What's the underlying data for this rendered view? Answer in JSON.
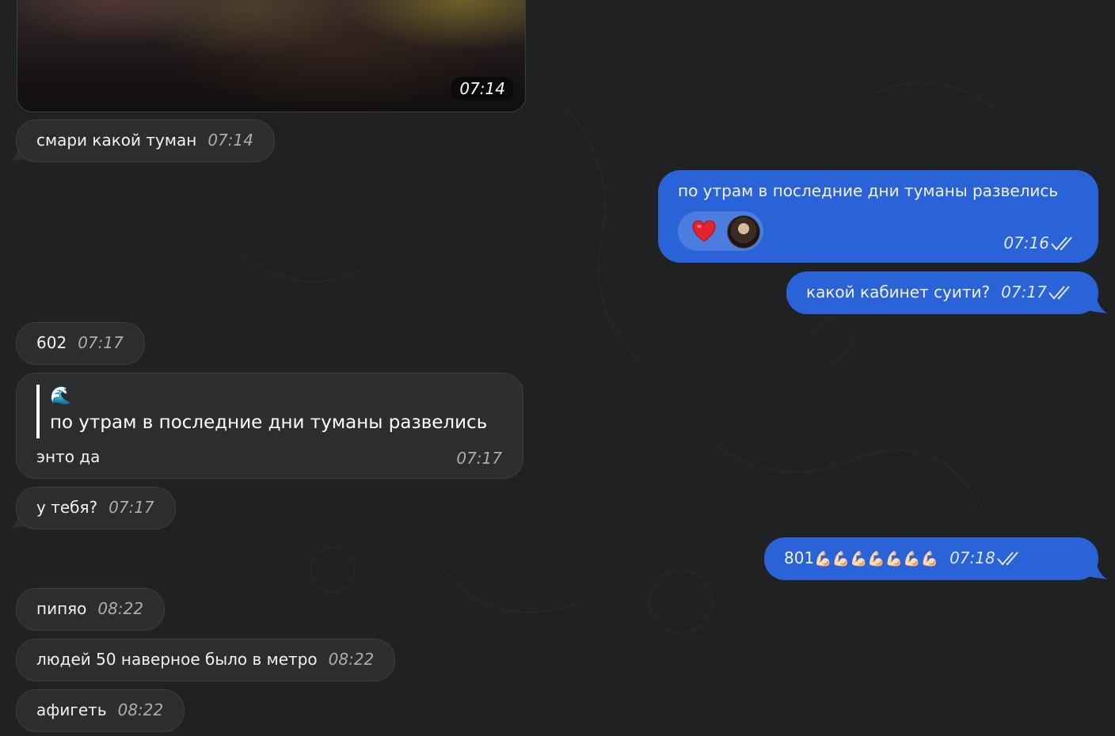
{
  "messages": {
    "photo": {
      "time": "07:14"
    },
    "m1": {
      "text": "смари какой туман",
      "time": "07:14"
    },
    "m2": {
      "text": "по утрам в последние дни туманы развелись",
      "time": "07:16",
      "reaction": "heart"
    },
    "m3": {
      "text": "какой кабинет суити?",
      "time": "07:17"
    },
    "m4": {
      "text": "602",
      "time": "07:17"
    },
    "m5": {
      "quote_emoji": "🌊",
      "quote_text": "по утрам в последние дни туманы развелись",
      "text": "энто да",
      "time": "07:17"
    },
    "m6": {
      "text": "у тебя?",
      "time": "07:17"
    },
    "m7": {
      "text": "801",
      "emoji": "💪🏻💪🏻💪🏻💪🏻💪🏻💪🏻💪🏻",
      "time": "07:18"
    },
    "m8": {
      "text": "пипяо",
      "time": "08:22"
    },
    "m9": {
      "text": "людей 50 наверное было в метро",
      "time": "08:22"
    },
    "m10": {
      "text": "афигеть",
      "time": "08:22"
    }
  },
  "colors": {
    "background": "#1f2123",
    "incoming_bubble": "#2b2d2f",
    "outgoing_bubble": "#2a63d8",
    "reaction_heart": "#e0242b"
  },
  "icons": {
    "read_status": "double-check-icon",
    "reaction": "heart-icon",
    "reactor": "avatar"
  }
}
